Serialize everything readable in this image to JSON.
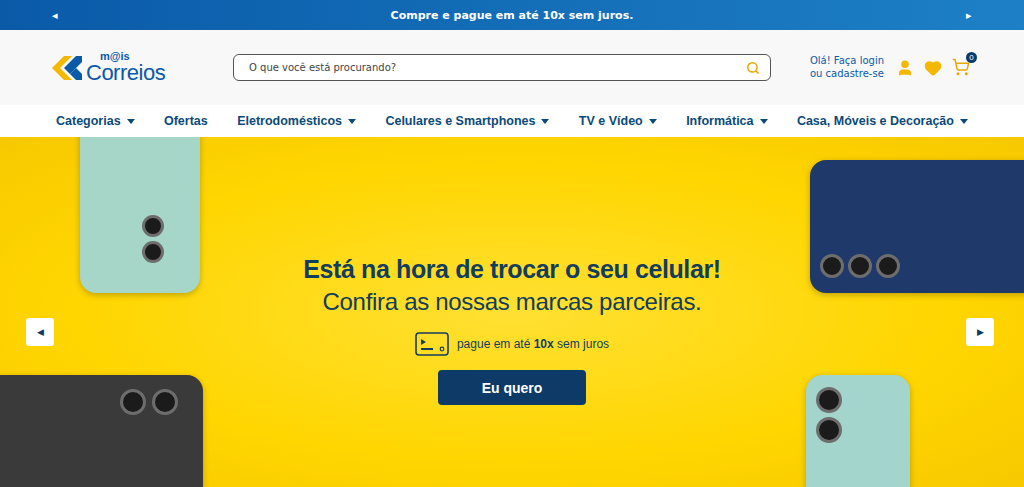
{
  "top_bar": {
    "message": "Compre e pague em até 10x sem juros.",
    "prev": "◂",
    "next": "▸"
  },
  "header": {
    "logo": {
      "prefix": "m@is",
      "name": "Correios"
    },
    "search": {
      "placeholder": "O que você está procurando?"
    },
    "account": {
      "line1": "Olá! Faça login",
      "line2": "ou cadastre-se"
    },
    "cart": {
      "count": "0"
    }
  },
  "nav": [
    {
      "label": "Categorias",
      "dropdown": true
    },
    {
      "label": "Ofertas",
      "dropdown": false
    },
    {
      "label": "Eletrodomésticos",
      "dropdown": true
    },
    {
      "label": "Celulares e Smartphones",
      "dropdown": true
    },
    {
      "label": "TV e Vídeo",
      "dropdown": true
    },
    {
      "label": "Informática",
      "dropdown": true
    },
    {
      "label": "Casa, Móveis e Decoração",
      "dropdown": true
    }
  ],
  "banner": {
    "title": "Está na hora de trocar o seu celular!",
    "subtitle": "Confira as nossas marcas parceiras.",
    "payment": {
      "prefix": "pague em até ",
      "highlight": "10x",
      "suffix": " sem juros"
    },
    "button": "Eu quero",
    "prev": "◀",
    "next": "▶"
  }
}
